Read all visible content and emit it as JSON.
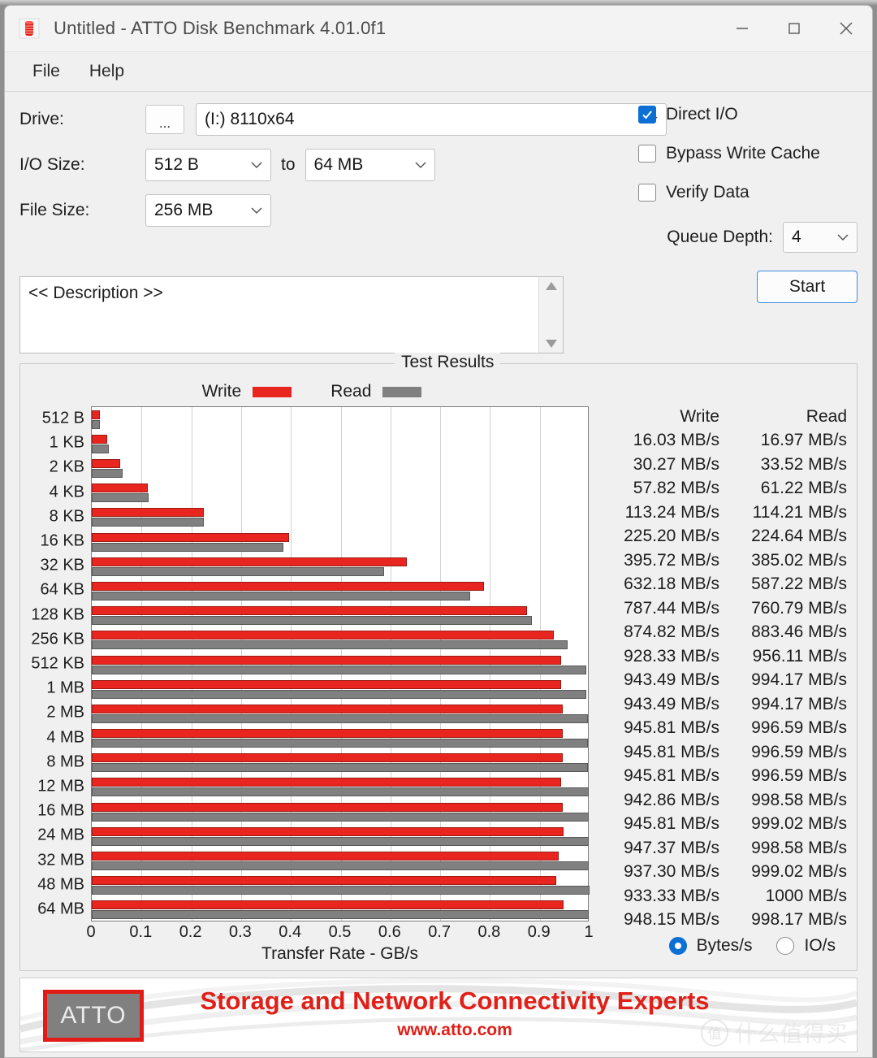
{
  "window": {
    "title": "Untitled - ATTO Disk Benchmark 4.01.0f1",
    "minimize_label": "minimize",
    "maximize_label": "maximize",
    "close_label": "close"
  },
  "menu": {
    "items": [
      "File",
      "Help"
    ]
  },
  "settings": {
    "drive_label": "Drive:",
    "browse_label": "...",
    "drive_value": "(I:) 8110x64",
    "io_size_label": "I/O Size:",
    "io_min_value": "512 B",
    "io_to_label": "to",
    "io_max_value": "64 MB",
    "file_size_label": "File Size:",
    "file_size_value": "256 MB"
  },
  "options": {
    "direct_io_label": "Direct I/O",
    "direct_io_checked": true,
    "bypass_write_cache_label": "Bypass Write Cache",
    "bypass_write_cache_checked": false,
    "verify_data_label": "Verify Data",
    "verify_data_checked": false,
    "queue_depth_label": "Queue Depth:",
    "queue_depth_value": "4",
    "start_label": "Start"
  },
  "description": {
    "placeholder": "<< Description >>"
  },
  "results": {
    "group_title": "Test Results",
    "legend": [
      {
        "label": "Write",
        "color": "#e8251e"
      },
      {
        "label": "Read",
        "color": "#808080"
      }
    ],
    "table_headers": [
      "Write",
      "Read"
    ],
    "units": {
      "bytes_label": "Bytes/s",
      "io_label": "IO/s",
      "selected": "Bytes/s"
    }
  },
  "banner": {
    "logo_text": "ATTO",
    "tagline": "Storage and Network Connectivity Experts",
    "url": "www.atto.com",
    "watermark_badge": "值",
    "watermark_text": "什么值得买"
  },
  "chart_data": {
    "type": "bar",
    "orientation": "horizontal",
    "title": "Test Results",
    "xlabel": "Transfer Rate - GB/s",
    "ylabel": "",
    "xlim": [
      0,
      1
    ],
    "xticks": [
      "0",
      "0.1",
      "0.2",
      "0.3",
      "0.4",
      "0.5",
      "0.6",
      "0.7",
      "0.8",
      "0.9",
      "1"
    ],
    "grid": true,
    "legend_position": "top-center",
    "categories": [
      "512 B",
      "1 KB",
      "2 KB",
      "4 KB",
      "8 KB",
      "16 KB",
      "32 KB",
      "64 KB",
      "128 KB",
      "256 KB",
      "512 KB",
      "1 MB",
      "2 MB",
      "4 MB",
      "8 MB",
      "12 MB",
      "16 MB",
      "24 MB",
      "32 MB",
      "48 MB",
      "64 MB"
    ],
    "series": [
      {
        "name": "Write",
        "color": "#e8251e",
        "unit": "MB/s",
        "values": [
          16.03,
          30.27,
          57.82,
          113.24,
          225.2,
          395.72,
          632.18,
          787.44,
          874.82,
          928.33,
          943.49,
          943.49,
          945.81,
          945.81,
          945.81,
          942.86,
          945.81,
          947.37,
          937.3,
          933.33,
          948.15
        ],
        "labels": [
          "16.03 MB/s",
          "30.27 MB/s",
          "57.82 MB/s",
          "113.24 MB/s",
          "225.20 MB/s",
          "395.72 MB/s",
          "632.18 MB/s",
          "787.44 MB/s",
          "874.82 MB/s",
          "928.33 MB/s",
          "943.49 MB/s",
          "943.49 MB/s",
          "945.81 MB/s",
          "945.81 MB/s",
          "945.81 MB/s",
          "942.86 MB/s",
          "945.81 MB/s",
          "947.37 MB/s",
          "937.30 MB/s",
          "933.33 MB/s",
          "948.15 MB/s"
        ]
      },
      {
        "name": "Read",
        "color": "#808080",
        "unit": "MB/s",
        "values": [
          16.97,
          33.52,
          61.22,
          114.21,
          224.64,
          385.02,
          587.22,
          760.79,
          883.46,
          956.11,
          994.17,
          994.17,
          996.59,
          996.59,
          996.59,
          998.58,
          999.02,
          998.58,
          999.02,
          1000,
          998.17
        ],
        "labels": [
          "16.97 MB/s",
          "33.52 MB/s",
          "61.22 MB/s",
          "114.21 MB/s",
          "224.64 MB/s",
          "385.02 MB/s",
          "587.22 MB/s",
          "760.79 MB/s",
          "883.46 MB/s",
          "956.11 MB/s",
          "994.17 MB/s",
          "994.17 MB/s",
          "996.59 MB/s",
          "996.59 MB/s",
          "996.59 MB/s",
          "998.58 MB/s",
          "999.02 MB/s",
          "998.58 MB/s",
          "999.02 MB/s",
          "1000 MB/s",
          "998.17 MB/s"
        ]
      }
    ]
  }
}
